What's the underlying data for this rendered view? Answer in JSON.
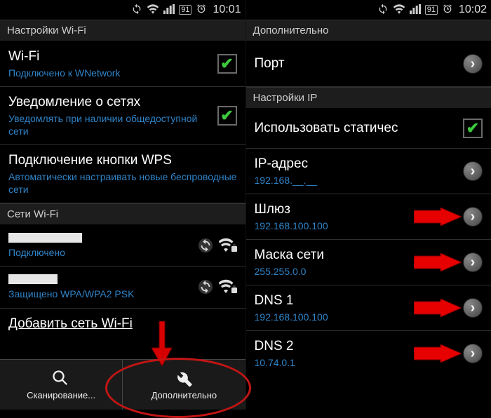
{
  "left": {
    "status": {
      "battery": "91",
      "time": "10:01"
    },
    "sections": {
      "wifi_settings_hdr": "Настройки Wi-Fi",
      "networks_hdr": "Сети Wi-Fi"
    },
    "wifi": {
      "title": "Wi-Fi",
      "sub": "Подключено к WNetwork",
      "checked": true
    },
    "notify": {
      "title": "Уведомление о сетях",
      "sub": "Уведомлять при наличии общедоступной сети",
      "checked": true
    },
    "wps": {
      "title": "Подключение кнопки WPS",
      "sub": "Автоматически настраивать новые беспроводные сети"
    },
    "nets": [
      {
        "ssid_width": 105,
        "sub": "Подключено"
      },
      {
        "ssid_width": 70,
        "sub": "Защищено WPA/WPA2 PSK"
      }
    ],
    "add_net": "Добавить сеть Wi-Fi",
    "menu": {
      "scan": "Сканирование...",
      "advanced": "Дополнительно"
    }
  },
  "right": {
    "status": {
      "battery": "91",
      "time": "10:02"
    },
    "hdr": "Дополнительно",
    "port": "Порт",
    "ip_hdr": "Настройки IP",
    "static": {
      "title": "Использовать статичес",
      "checked": true
    },
    "rows": {
      "ip": {
        "title": "IP-адрес",
        "sub": "192.168.__.__"
      },
      "gw": {
        "title": "Шлюз",
        "sub": "192.168.100.100"
      },
      "mask": {
        "title": "Маска сети",
        "sub": "255.255.0.0"
      },
      "dns1": {
        "title": "DNS 1",
        "sub": "192.168.100.100"
      },
      "dns2": {
        "title": "DNS 2",
        "sub": "10.74.0.1"
      }
    }
  }
}
